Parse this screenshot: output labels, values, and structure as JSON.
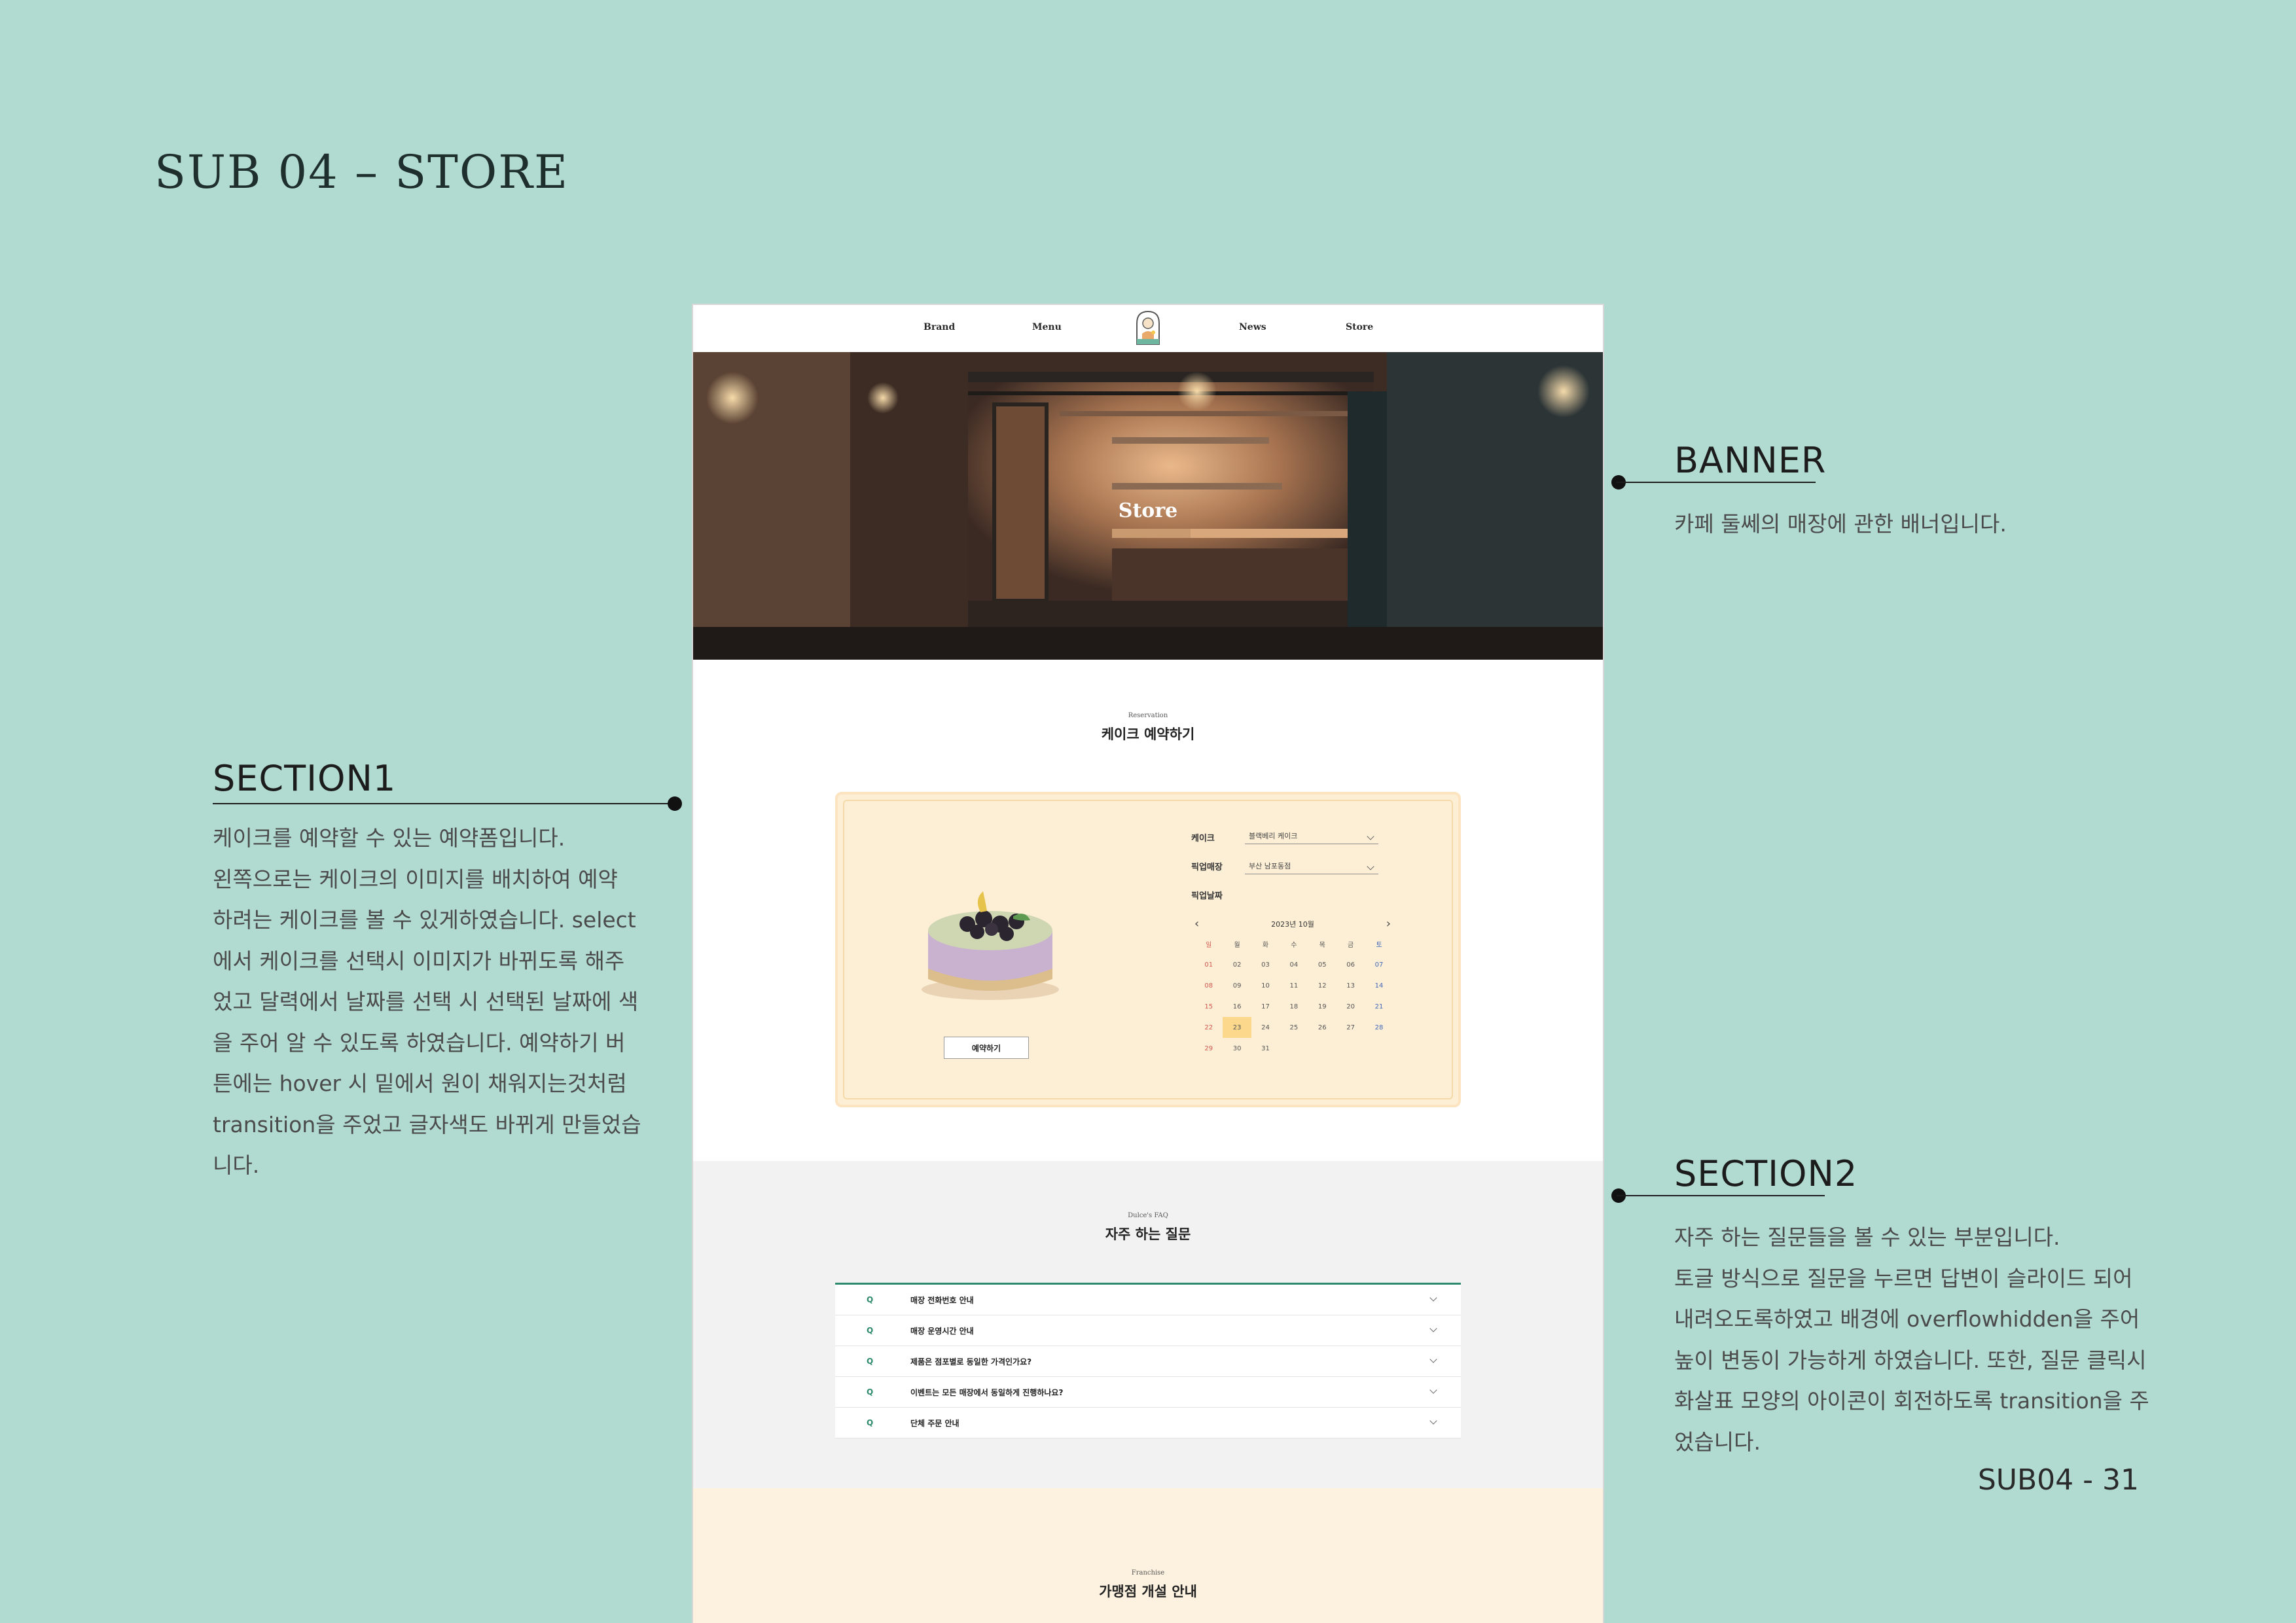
{
  "page": {
    "title": "SUB 04 – STORE",
    "page_number": "SUB04 - 31"
  },
  "annotations": {
    "banner": {
      "title": "BANNER",
      "lines": [
        "카페 둘쎄의 매장에 관한 배너입니다."
      ]
    },
    "section1": {
      "title": "SECTION1",
      "lines": [
        "케이크를 예약할 수 있는 예약폼입니다.",
        "왼쪽으로는 케이크의 이미지를 배치하여 예약",
        "하려는 케이크를 볼 수 있게하였습니다. select",
        "에서 케이크를 선택시 이미지가 바뀌도록 해주",
        "었고 달력에서 날짜를 선택 시 선택된 날짜에 색",
        "을 주어 알 수 있도록 하였습니다.  예약하기 버",
        "튼에는 hover 시 밑에서 원이 채워지는것처럼",
        "transition을 주었고 글자색도 바뀌게 만들었습",
        "니다."
      ]
    },
    "section2": {
      "title": "SECTION2",
      "lines": [
        "자주 하는 질문들을 볼 수 있는 부분입니다.",
        "토글 방식으로 질문을 누르면 답변이 슬라이드 되어",
        "내려오도록하였고 배경에 overflowhidden을 주어",
        "높이 변동이 가능하게 하였습니다. 또한, 질문 클릭시",
        "화살표 모양의 아이콘이 회전하도록 transition을 주",
        "었습니다."
      ]
    }
  },
  "mockup": {
    "nav": [
      "Brand",
      "Menu",
      "News",
      "Store"
    ],
    "logo_icon": "cafe-logo-icon",
    "banner_title": "Store",
    "reservation": {
      "subtitle": "Reservation",
      "title": "케이크 예약하기",
      "cake_label": "케이크",
      "cake_value": "블랙베리 케이크",
      "store_label": "픽업매장",
      "store_value": "부산 남포동점",
      "date_label": "픽업날짜",
      "calendar_month": "2023년 10월",
      "weekdays": [
        "일",
        "월",
        "화",
        "수",
        "목",
        "금",
        "토"
      ],
      "days": [
        "01",
        "02",
        "03",
        "04",
        "05",
        "06",
        "07",
        "08",
        "09",
        "10",
        "11",
        "12",
        "13",
        "14",
        "15",
        "16",
        "17",
        "18",
        "19",
        "20",
        "21",
        "22",
        "23",
        "24",
        "25",
        "26",
        "27",
        "28",
        "29",
        "30",
        "31"
      ],
      "selected_day": "23",
      "button": "예약하기"
    },
    "faq": {
      "subtitle": "Dulce's FAQ",
      "title": "자주 하는 질문",
      "q_mark": "Q",
      "items": [
        "매장 전화번호 안내",
        "매장 운영시간 안내",
        "제품은 점포별로 동일한 가격인가요?",
        "이벤트는 모든 매장에서 동일하게 진행하나요?",
        "단체 주문 안내"
      ]
    },
    "franchise": {
      "subtitle": "Franchise",
      "title": "가맹점 개설 안내"
    }
  },
  "colors": {
    "background": "#b1dbd1",
    "accent_green": "#2e8a6d",
    "reservation_bg": "#fdefd6",
    "selected_day": "#fbd88c",
    "faq_bg": "#f2f2f2",
    "franchise_bg": "#fdf2e0"
  }
}
